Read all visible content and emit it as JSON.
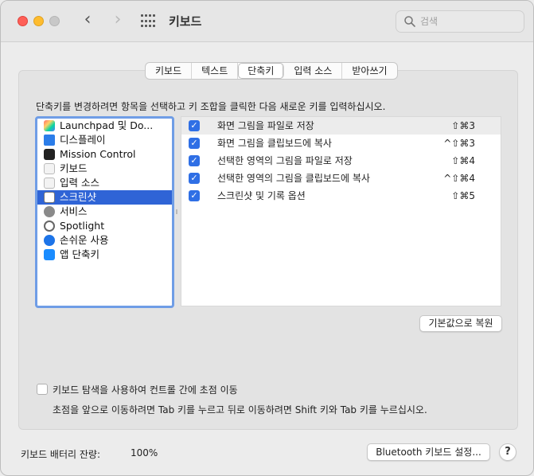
{
  "window": {
    "title": "키보드",
    "search_placeholder": "검색",
    "nav_back": "‹",
    "nav_forward": "›"
  },
  "tabs": [
    {
      "label": "키보드",
      "active": false
    },
    {
      "label": "텍스트",
      "active": false
    },
    {
      "label": "단축키",
      "active": true
    },
    {
      "label": "입력 소스",
      "active": false
    },
    {
      "label": "받아쓰기",
      "active": false
    }
  ],
  "instruction": "단축키를 변경하려면 항목을 선택하고 키 조합을 클릭한 다음 새로운 키를 입력하십시오.",
  "categories": [
    {
      "label": "Launchpad 및 Do...",
      "icon": "launchpad-icon"
    },
    {
      "label": "디스플레이",
      "icon": "display-icon"
    },
    {
      "label": "Mission Control",
      "icon": "mission-control-icon"
    },
    {
      "label": "키보드",
      "icon": "keyboard-icon"
    },
    {
      "label": "입력 소스",
      "icon": "input-source-icon"
    },
    {
      "label": "스크린샷",
      "icon": "screenshot-icon",
      "selected": true
    },
    {
      "label": "서비스",
      "icon": "services-gear-icon"
    },
    {
      "label": "Spotlight",
      "icon": "spotlight-icon"
    },
    {
      "label": "손쉬운 사용",
      "icon": "accessibility-icon"
    },
    {
      "label": "앱 단축키",
      "icon": "app-shortcuts-icon"
    }
  ],
  "shortcuts": [
    {
      "label": "화면 그림을 파일로 저장",
      "keys": "⇧⌘3",
      "checked": true
    },
    {
      "label": "화면 그림을 클립보드에 복사",
      "keys": "^⇧⌘3",
      "checked": true
    },
    {
      "label": "선택한 영역의 그림을 파일로 저장",
      "keys": "⇧⌘4",
      "checked": true
    },
    {
      "label": "선택한 영역의 그림을 클립보드에 복사",
      "keys": "^⇧⌘4",
      "checked": true
    },
    {
      "label": "스크린샷 및 기록 옵션",
      "keys": "⇧⌘5",
      "checked": true
    }
  ],
  "restore_button": "기본값으로 복원",
  "keyboard_navigation": {
    "checked": false,
    "label": "키보드 탐색을 사용하여 컨트롤 간에 초점 이동",
    "hint": "초점을 앞으로 이동하려면 Tab 키를 누르고 뒤로 이동하려면 Shift 키와 Tab 키를 누르십시오."
  },
  "footer": {
    "battery_label": "키보드 배터리 잔량:",
    "battery_value": "100%",
    "bluetooth_button": "Bluetooth 키보드 설정...",
    "help_button": "?"
  },
  "colors": {
    "accent": "#2f64d6",
    "close": "#fe5f57",
    "minimize": "#febc2e"
  }
}
